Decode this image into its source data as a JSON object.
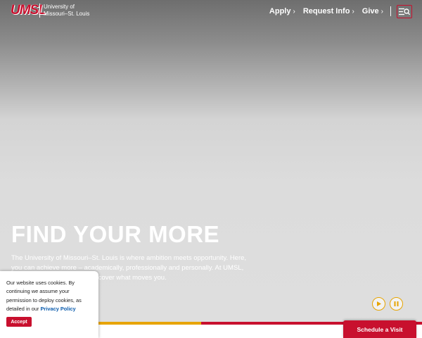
{
  "header": {
    "logo_text": "UMSL",
    "university_line1": "University of",
    "university_line2": "Missouri–St. Louis",
    "nav": [
      {
        "label": "Apply",
        "chevron": "›"
      },
      {
        "label": "Request Info",
        "chevron": "›"
      },
      {
        "label": "Give",
        "chevron": "›"
      }
    ],
    "menu_icon": "menu-search-icon"
  },
  "hero": {
    "headline": "FIND YOUR MORE",
    "intro": "The University of Missouri–St. Louis is where ambition meets opportunity. Here, you can achieve more – academically, professionally and personally. At UMSL, explore the possibilities to discover what moves you."
  },
  "media_controls": {
    "play_icon": "play-icon",
    "pause_icon": "pause-icon"
  },
  "cookie_banner": {
    "text": "Our website uses cookies. By continuing we assume your permission to deploy cookies, as detailed in our",
    "link": "Privacy Policy",
    "accept_label": "Accept"
  },
  "cta": {
    "schedule_label": "Schedule a Visit"
  },
  "colors": {
    "brand_red": "#c8102e",
    "brand_gold": "#e7a400",
    "link_blue": "#0b5cad"
  }
}
